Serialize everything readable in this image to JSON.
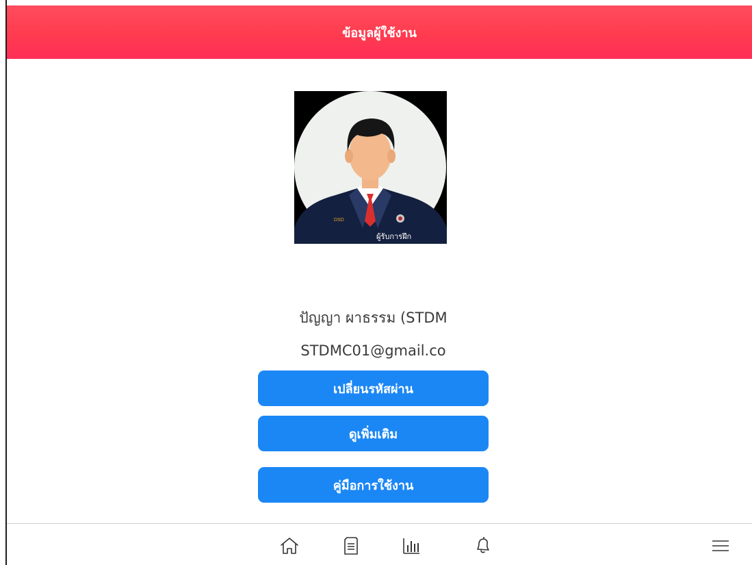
{
  "header": {
    "title": "ข้อมูลผู้ใช้งาน"
  },
  "profile": {
    "avatar_caption": "ผู้รับการฝึก",
    "badge_text": "DSD",
    "name": "ปัญญา ผาธรรม (STDM",
    "email": "STDMC01@gmail.co"
  },
  "actions": {
    "change_password": "เปลี่ยนรหัสผ่าน",
    "view_more": "ดูเพิ่มเติม",
    "user_manual": "คู่มือการใช้งาน"
  },
  "bottom_nav": {
    "items": [
      {
        "icon": "home-icon"
      },
      {
        "icon": "document-icon"
      },
      {
        "icon": "bar-chart-icon"
      },
      {
        "icon": "bell-icon"
      },
      {
        "icon": "menu-icon"
      }
    ]
  },
  "colors": {
    "header": "#ff3b4f",
    "button": "#1b87f5",
    "text": "#3a3a3a"
  }
}
